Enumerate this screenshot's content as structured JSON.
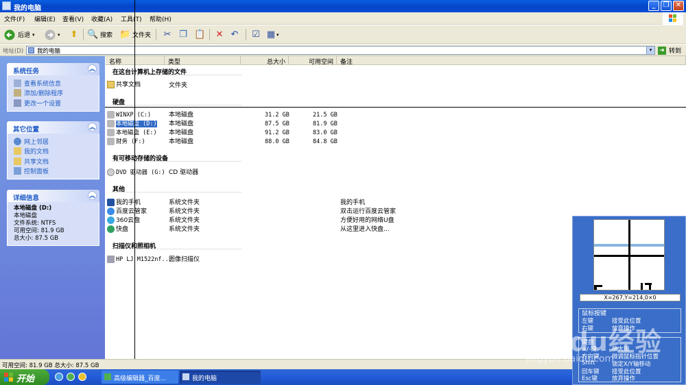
{
  "window": {
    "title": "我的电脑"
  },
  "menu": [
    "文件(F)",
    "编辑(E)",
    "查看(V)",
    "收藏(A)",
    "工具(T)",
    "帮助(H)"
  ],
  "toolbar": {
    "back": "后退",
    "search": "搜索",
    "folders": "文件夹"
  },
  "address": {
    "label": "地址(D)",
    "value": "我的电脑",
    "go": "转到"
  },
  "left": {
    "system_tasks": {
      "title": "系统任务",
      "items": [
        "查看系统信息",
        "添加/删除程序",
        "更改一个设置"
      ]
    },
    "other_places": {
      "title": "其它位置",
      "items": [
        "网上邻居",
        "我的文档",
        "共享文档",
        "控制面板"
      ]
    },
    "details": {
      "title": "详细信息",
      "name": "本地磁盘 (D:)",
      "type": "本地磁盘",
      "fs": "文件系统: NTFS",
      "free": "可用空间: 81.9 GB",
      "total": "总大小: 87.5 GB"
    }
  },
  "columns": [
    "名称",
    "类型",
    "总大小",
    "可用空间",
    "备注"
  ],
  "groups": {
    "stored": "在这台计算机上存储的文件",
    "hdd": "硬盘",
    "removable": "有可移动存储的设备",
    "other": "其他",
    "scanners": "扫描仪和照相机"
  },
  "shared": {
    "name": "共享文档",
    "type": "文件夹"
  },
  "drives": [
    {
      "name": "WINXP (C:)",
      "type": "本地磁盘",
      "total": "31.2 GB",
      "free": "21.5 GB"
    },
    {
      "name": "本地磁盘 (D:)",
      "type": "本地磁盘",
      "total": "87.5 GB",
      "free": "81.9 GB"
    },
    {
      "name": "本地磁盘 (E:)",
      "type": "本地磁盘",
      "total": "91.2 GB",
      "free": "83.0 GB"
    },
    {
      "name": "财务 (F:)",
      "type": "本地磁盘",
      "total": "88.0 GB",
      "free": "84.8 GB"
    }
  ],
  "dvd": {
    "name": "DVD 驱动器 (G:)",
    "type": "CD 驱动器"
  },
  "others": [
    {
      "name": "我的手机",
      "type": "系统文件夹",
      "note": "我的手机"
    },
    {
      "name": "百度云管家",
      "type": "系统文件夹",
      "note": "双击运行百度云管家"
    },
    {
      "name": "360云盘",
      "type": "系统文件夹",
      "note": "方便好用的网络U盘"
    },
    {
      "name": "快盘",
      "type": "系统文件夹",
      "note": "从这里进入快盘..."
    }
  ],
  "scanner": {
    "name": "HP LJ M1522nf...",
    "type": "图像扫描仪"
  },
  "status": "可用空间: 81.9 GB 总大小: 87.5 GB",
  "taskbar": {
    "start": "开始",
    "tasks": [
      "高级编辑器_百度...",
      "我的电脑"
    ]
  },
  "magnifier": {
    "coord": "X=267,Y=214,0×0",
    "mouse_keys_title": "鼠标按键",
    "mouse_left": "左键",
    "mouse_left_desc": "接受此位置",
    "mouse_right": "右键",
    "mouse_right_desc": "放弃操作",
    "kb_title": "键盘",
    "kb_rows": [
      {
        "key": "+/-键",
        "desc": "放大镜"
      },
      {
        "key": "方向键",
        "desc": "微调鼠标指针位置"
      },
      {
        "key": "Shift",
        "desc": "锁定X/Y轴移动"
      },
      {
        "key": "回车键",
        "desc": "接受此位置"
      },
      {
        "key": "Esc键",
        "desc": "放弃操作"
      }
    ]
  },
  "watermark": {
    "main": "Baidu经验",
    "sub": "jingyan.baidu.com"
  }
}
